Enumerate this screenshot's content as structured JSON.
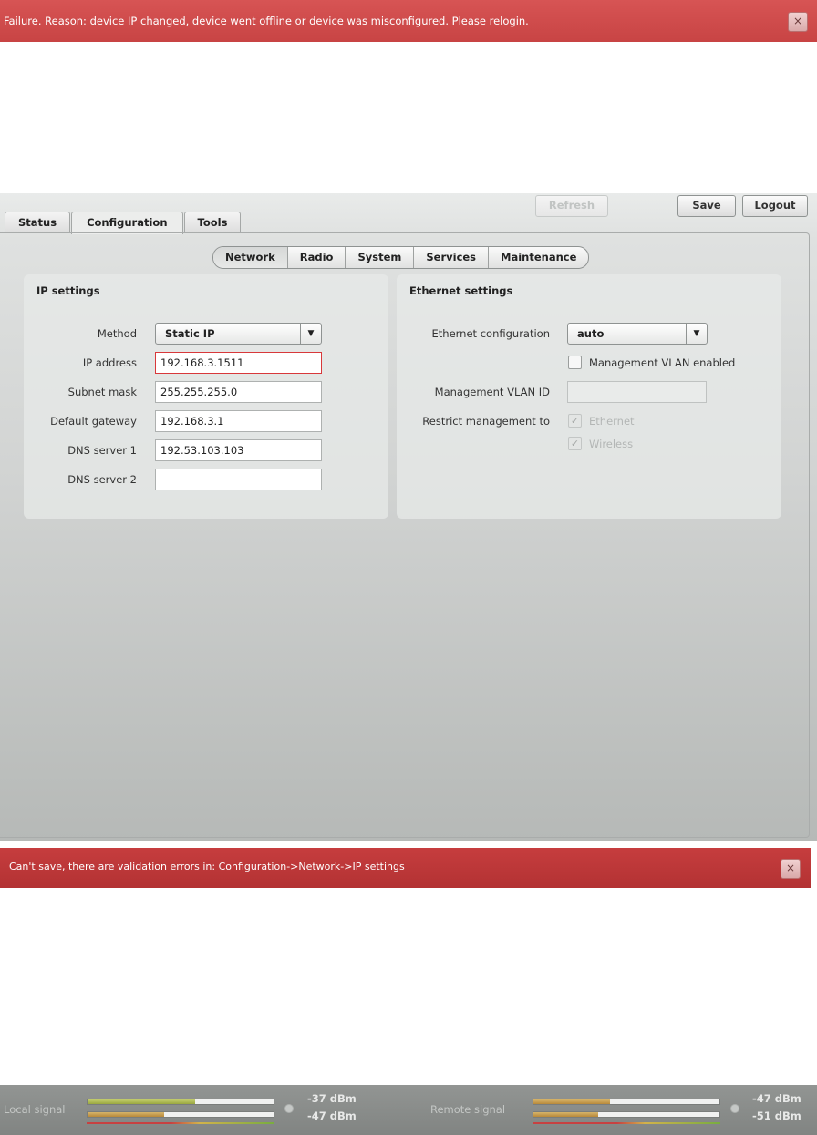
{
  "notifications": {
    "top_message": "Failure. Reason: device IP changed, device went offline or device was misconfigured. Please relogin.",
    "bottom_message": "Can't save, there are validation errors in: Configuration->Network->IP settings",
    "close_glyph": "×"
  },
  "toolbar": {
    "refresh_label": "Refresh",
    "save_label": "Save",
    "logout_label": "Logout"
  },
  "tabs": [
    {
      "label": "Status"
    },
    {
      "label": "Configuration",
      "active": true
    },
    {
      "label": "Tools"
    }
  ],
  "subtabs": [
    {
      "label": "Network",
      "active": true
    },
    {
      "label": "Radio"
    },
    {
      "label": "System"
    },
    {
      "label": "Services"
    },
    {
      "label": "Maintenance"
    }
  ],
  "ip_settings": {
    "title": "IP settings",
    "method_label": "Method",
    "method_value": "Static IP",
    "ip_label": "IP address",
    "ip_value": "192.168.3.1511",
    "mask_label": "Subnet mask",
    "mask_value": "255.255.255.0",
    "gateway_label": "Default gateway",
    "gateway_value": "192.168.3.1",
    "dns1_label": "DNS server 1",
    "dns1_value": "192.53.103.103",
    "dns2_label": "DNS server 2",
    "dns2_value": ""
  },
  "ethernet_settings": {
    "title": "Ethernet settings",
    "config_label": "Ethernet configuration",
    "config_value": "auto",
    "vlan_enabled_label": "Management VLAN enabled",
    "vlan_enabled_checked": false,
    "vlan_id_label": "Management VLAN ID",
    "vlan_id_value": "",
    "restrict_label": "Restrict management to",
    "restrict_ethernet_label": "Ethernet",
    "restrict_wireless_label": "Wireless",
    "restrict_ethernet_checked": true,
    "restrict_wireless_checked": true
  },
  "signal": {
    "local_label": "Local signal",
    "local_value_1": "-37 dBm",
    "local_value_2": "-47 dBm",
    "local_level_1": 0.58,
    "local_level_2": 0.41,
    "remote_label": "Remote signal",
    "remote_value_1": "-47 dBm",
    "remote_value_2": "-51 dBm",
    "remote_level_1": 0.41,
    "remote_level_2": 0.35
  },
  "colors": {
    "error_banner": "#c84444",
    "error_border": "#d8383a",
    "signal_green": "#9aa73f",
    "signal_orange": "#b8893a"
  }
}
